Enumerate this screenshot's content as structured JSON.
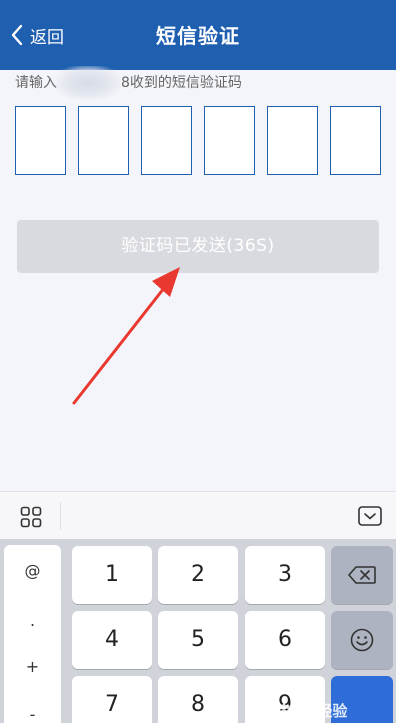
{
  "header": {
    "back_label": "返回",
    "title": "短信验证"
  },
  "hint": {
    "prefix": "请输入",
    "suffix": "8收到的短信验证码"
  },
  "code_boxes": [
    "",
    "",
    "",
    "",
    "",
    ""
  ],
  "send_button": {
    "label": "验证码已发送(36S)"
  },
  "keyboard": {
    "symbols": [
      "@",
      ".",
      "+",
      "-"
    ],
    "keys": {
      "k1": "1",
      "k2": "2",
      "k3": "3",
      "k4": "4",
      "k5": "5",
      "k6": "6",
      "k7": "7",
      "k8": "8",
      "k9": "9"
    }
  },
  "watermark": {
    "text": "Bai经验"
  },
  "colors": {
    "header_bg": "#1f5fb0",
    "box_border": "#1f5fb0",
    "button_disabled": "#d9dadf",
    "arrow": "#e8382f"
  }
}
